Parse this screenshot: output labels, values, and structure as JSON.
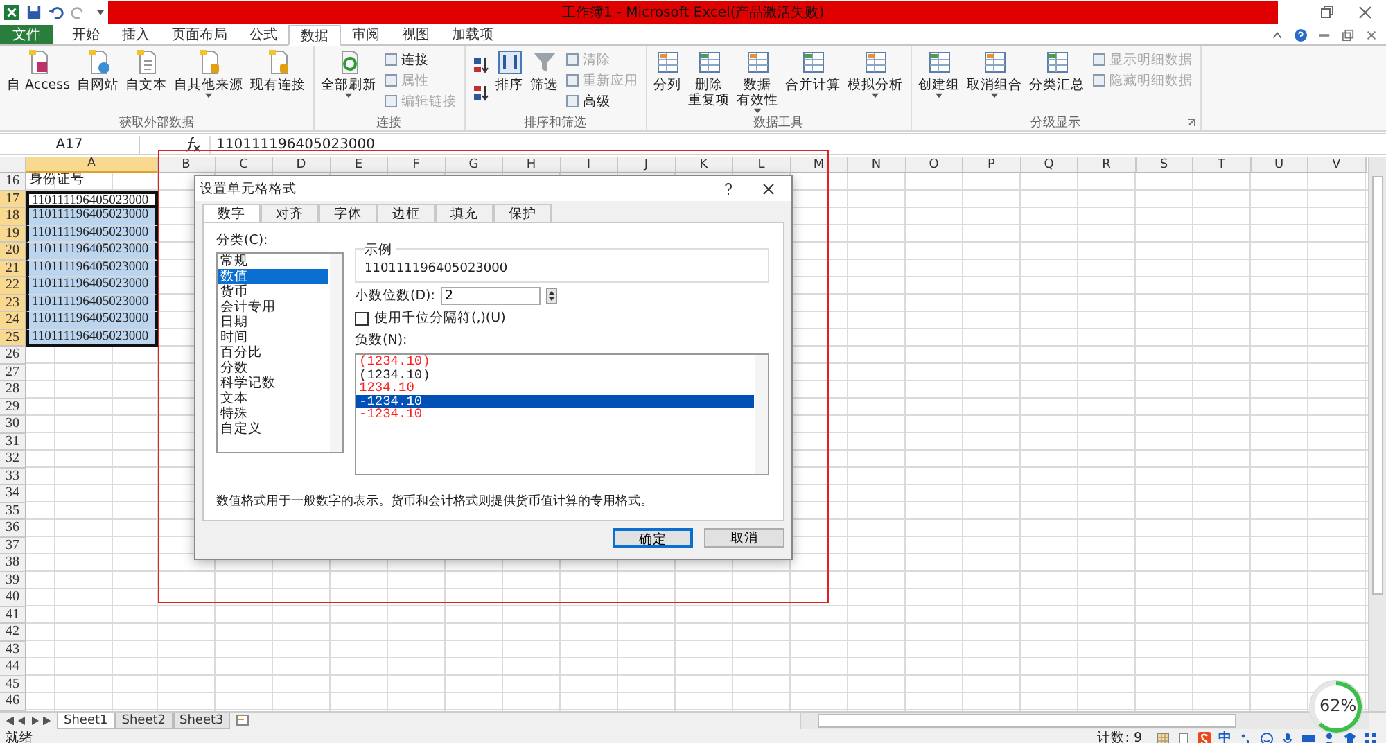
{
  "window": {
    "title": "工作簿1 - Microsoft Excel(产品激活失败)"
  },
  "ribbon_tabs": [
    {
      "label": "文件",
      "kind": "file",
      "selected": false
    },
    {
      "label": "开始",
      "kind": "tab",
      "selected": false
    },
    {
      "label": "插入",
      "kind": "tab",
      "selected": false
    },
    {
      "label": "页面布局",
      "kind": "tab",
      "selected": false
    },
    {
      "label": "公式",
      "kind": "tab",
      "selected": false
    },
    {
      "label": "数据",
      "kind": "tab",
      "selected": true
    },
    {
      "label": "审阅",
      "kind": "tab",
      "selected": false
    },
    {
      "label": "视图",
      "kind": "tab",
      "selected": false
    },
    {
      "label": "加载项",
      "kind": "tab",
      "selected": false
    }
  ],
  "ribbon_groups": [
    {
      "label": "获取外部数据",
      "launcher": false,
      "items": [
        {
          "kind": "large",
          "label": "自 Access",
          "dropdown": false
        },
        {
          "kind": "large",
          "label": "自网站",
          "dropdown": false
        },
        {
          "kind": "large",
          "label": "自文本",
          "dropdown": false
        },
        {
          "kind": "large",
          "label": "自其他来源",
          "dropdown": true
        },
        {
          "kind": "large",
          "label": "现有连接",
          "dropdown": false
        }
      ]
    },
    {
      "label": "连接",
      "launcher": false,
      "items": [
        {
          "kind": "large",
          "label": "全部刷新",
          "dropdown": true
        },
        {
          "kind": "stack",
          "items": [
            {
              "label": "连接",
              "disabled": false
            },
            {
              "label": "属性",
              "disabled": true
            },
            {
              "label": "编辑链接",
              "disabled": true
            }
          ]
        }
      ]
    },
    {
      "label": "排序和筛选",
      "launcher": false,
      "items": [
        {
          "kind": "sort_icons"
        },
        {
          "kind": "large",
          "label": "排序",
          "dropdown": false
        },
        {
          "kind": "large",
          "label": "筛选",
          "dropdown": false
        },
        {
          "kind": "stack",
          "items": [
            {
              "label": "清除",
              "disabled": true
            },
            {
              "label": "重新应用",
              "disabled": true
            },
            {
              "label": "高级",
              "disabled": false
            }
          ]
        }
      ]
    },
    {
      "label": "数据工具",
      "launcher": false,
      "items": [
        {
          "kind": "large",
          "label": "分列",
          "dropdown": false
        },
        {
          "kind": "large",
          "label": "删除",
          "label2": "重复项",
          "dropdown": false
        },
        {
          "kind": "large",
          "label": "数据",
          "label2": "有效性",
          "dropdown": true
        },
        {
          "kind": "large",
          "label": "合并计算",
          "dropdown": false
        },
        {
          "kind": "large",
          "label": "模拟分析",
          "dropdown": true
        }
      ]
    },
    {
      "label": "分级显示",
      "launcher": true,
      "items": [
        {
          "kind": "large",
          "label": "创建组",
          "dropdown": true
        },
        {
          "kind": "large",
          "label": "取消组合",
          "dropdown": true
        },
        {
          "kind": "large",
          "label": "分类汇总",
          "dropdown": false
        },
        {
          "kind": "stack",
          "items": [
            {
              "label": "显示明细数据",
              "disabled": true
            },
            {
              "label": "隐藏明细数据",
              "disabled": true
            }
          ]
        }
      ]
    }
  ],
  "name_box": "A17",
  "formula": "110111196405023000",
  "columns": [
    {
      "label": "A",
      "selected": true
    },
    {
      "label": "B",
      "selected": false
    },
    {
      "label": "C",
      "selected": false
    },
    {
      "label": "D",
      "selected": false
    },
    {
      "label": "E",
      "selected": false
    },
    {
      "label": "F",
      "selected": false
    },
    {
      "label": "G",
      "selected": false
    },
    {
      "label": "H",
      "selected": false
    },
    {
      "label": "I",
      "selected": false
    },
    {
      "label": "J",
      "selected": false
    },
    {
      "label": "K",
      "selected": false
    },
    {
      "label": "L",
      "selected": false
    },
    {
      "label": "M",
      "selected": false
    },
    {
      "label": "N",
      "selected": false
    },
    {
      "label": "O",
      "selected": false
    },
    {
      "label": "P",
      "selected": false
    },
    {
      "label": "Q",
      "selected": false
    },
    {
      "label": "R",
      "selected": false
    },
    {
      "label": "S",
      "selected": false
    },
    {
      "label": "T",
      "selected": false
    },
    {
      "label": "U",
      "selected": false
    },
    {
      "label": "V",
      "selected": false
    }
  ],
  "rows": [
    {
      "number": "16",
      "cell": "身份证号",
      "selected": false,
      "active": false
    },
    {
      "number": "17",
      "cell": "110111196405023000",
      "selected": true,
      "active": true
    },
    {
      "number": "18",
      "cell": "110111196405023000",
      "selected": true,
      "active": false
    },
    {
      "number": "19",
      "cell": "110111196405023000",
      "selected": true,
      "active": false
    },
    {
      "number": "20",
      "cell": "110111196405023000",
      "selected": true,
      "active": false
    },
    {
      "number": "21",
      "cell": "110111196405023000",
      "selected": true,
      "active": false
    },
    {
      "number": "22",
      "cell": "110111196405023000",
      "selected": true,
      "active": false
    },
    {
      "number": "23",
      "cell": "110111196405023000",
      "selected": true,
      "active": false
    },
    {
      "number": "24",
      "cell": "110111196405023000",
      "selected": true,
      "active": false
    },
    {
      "number": "25",
      "cell": "110111196405023000",
      "selected": true,
      "active": false
    },
    {
      "number": "26",
      "selected": false
    },
    {
      "number": "27",
      "selected": false
    },
    {
      "number": "28",
      "selected": false
    },
    {
      "number": "29",
      "selected": false
    },
    {
      "number": "30",
      "selected": false
    },
    {
      "number": "31",
      "selected": false
    },
    {
      "number": "32",
      "selected": false
    },
    {
      "number": "33",
      "selected": false
    },
    {
      "number": "34",
      "selected": false
    },
    {
      "number": "35",
      "selected": false
    },
    {
      "number": "36",
      "selected": false
    },
    {
      "number": "37",
      "selected": false
    },
    {
      "number": "38",
      "selected": false
    },
    {
      "number": "39",
      "selected": false
    },
    {
      "number": "40",
      "selected": false
    },
    {
      "number": "41",
      "selected": false
    },
    {
      "number": "42",
      "selected": false
    },
    {
      "number": "43",
      "selected": false
    },
    {
      "number": "44",
      "selected": false
    },
    {
      "number": "45",
      "selected": false
    },
    {
      "number": "46",
      "selected": false
    }
  ],
  "sheet_tabs": [
    {
      "label": "Sheet1",
      "selected": true
    },
    {
      "label": "Sheet2",
      "selected": false
    },
    {
      "label": "Sheet3",
      "selected": false
    }
  ],
  "status_bar": {
    "ready": "就绪",
    "count": "计数: 9",
    "ime": "中"
  },
  "gauge": {
    "text": "62%",
    "level": 0.62
  },
  "dialog": {
    "title": "设置单元格格式",
    "tabs": [
      {
        "label": "数字",
        "selected": true
      },
      {
        "label": "对齐",
        "selected": false
      },
      {
        "label": "字体",
        "selected": false
      },
      {
        "label": "边框",
        "selected": false
      },
      {
        "label": "填充",
        "selected": false
      },
      {
        "label": "保护",
        "selected": false
      }
    ],
    "category_label": "分类(C):",
    "categories": [
      {
        "label": "常规",
        "selected": false
      },
      {
        "label": "数值",
        "selected": true
      },
      {
        "label": "货币",
        "selected": false
      },
      {
        "label": "会计专用",
        "selected": false
      },
      {
        "label": "日期",
        "selected": false
      },
      {
        "label": "时间",
        "selected": false
      },
      {
        "label": "百分比",
        "selected": false
      },
      {
        "label": "分数",
        "selected": false
      },
      {
        "label": "科学记数",
        "selected": false
      },
      {
        "label": "文本",
        "selected": false
      },
      {
        "label": "特殊",
        "selected": false
      },
      {
        "label": "自定义",
        "selected": false
      }
    ],
    "sample_label": "示例",
    "sample": "110111196405023000",
    "decimal_label": "小数位数(D):",
    "decimal_value": "2",
    "separator": {
      "label": "使用千位分隔符(,)(U)",
      "checked": false
    },
    "negative_label": "负数(N):",
    "negatives": [
      {
        "label": "(1234.10)",
        "red": true,
        "selected": false
      },
      {
        "label": "(1234.10)",
        "red": false,
        "selected": false
      },
      {
        "label": "1234.10",
        "red": true,
        "selected": false
      },
      {
        "label": "-1234.10",
        "red": false,
        "selected": true
      },
      {
        "label": "-1234.10",
        "red": true,
        "selected": false
      }
    ],
    "description": "数值格式用于一般数字的表示。货币和会计格式则提供货币值计算的专用格式。",
    "buttons": [
      {
        "label": "确定",
        "kind": "primary"
      },
      {
        "label": "取消",
        "kind": "normal"
      }
    ]
  }
}
